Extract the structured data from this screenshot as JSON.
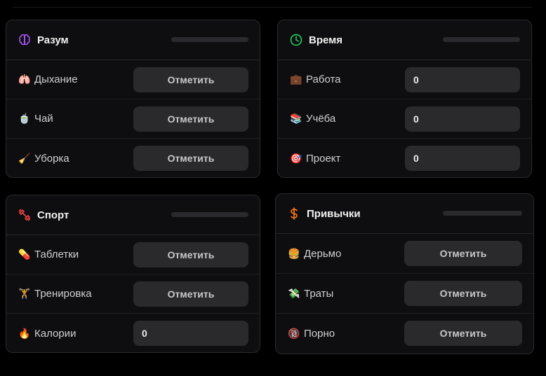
{
  "colors": {
    "mind_icon": "#a855f7",
    "time_icon": "#22c55e",
    "sport_icon": "#ef4444",
    "habits_icon": "#f97316"
  },
  "cards": {
    "mind": {
      "icon": "brain-icon",
      "title": "Разум",
      "rows": [
        {
          "emoji": "🫁",
          "label": "Дыхание",
          "button": "Отметить"
        },
        {
          "emoji": "🍵",
          "label": "Чай",
          "button": "Отметить"
        },
        {
          "emoji": "🧹",
          "label": "Уборка",
          "button": "Отметить"
        }
      ]
    },
    "time": {
      "icon": "clock-icon",
      "title": "Время",
      "rows": [
        {
          "emoji": "💼",
          "label": "Работа",
          "value": "0"
        },
        {
          "emoji": "📚",
          "label": "Учёба",
          "value": "0"
        },
        {
          "emoji": "🎯",
          "label": "Проект",
          "value": "0"
        }
      ]
    },
    "sport": {
      "icon": "dumbbell-icon",
      "title": "Спорт",
      "rows": [
        {
          "emoji": "💊",
          "label": "Таблетки",
          "button": "Отметить"
        },
        {
          "emoji": "🏋",
          "label": "Тренировка",
          "button": "Отметить"
        },
        {
          "emoji": "🔥",
          "label": "Калории",
          "value": "0"
        }
      ]
    },
    "habits": {
      "icon": "dollar-icon",
      "title": "Привычки",
      "rows": [
        {
          "emoji": "🍔",
          "label": "Дерьмо",
          "button": "Отметить"
        },
        {
          "emoji": "💸",
          "label": "Траты",
          "button": "Отметить"
        },
        {
          "emoji": "🔞",
          "label": "Порно",
          "button": "Отметить"
        }
      ]
    }
  }
}
